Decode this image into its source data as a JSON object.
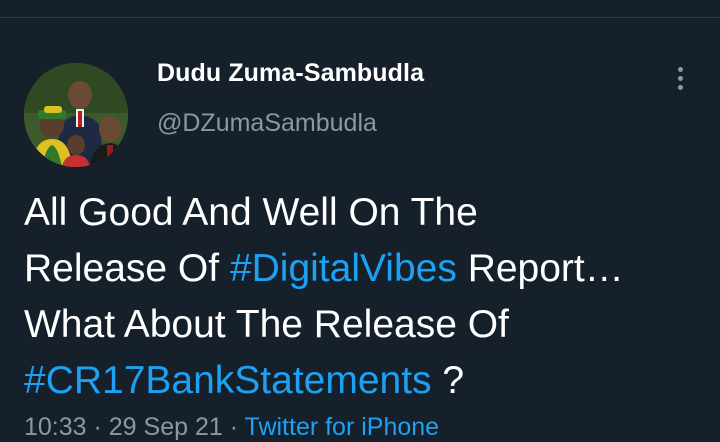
{
  "author": {
    "display_name": "Dudu Zuma-Sambudla",
    "handle": "@DZumaSambudla"
  },
  "tweet": {
    "line1": "All Good And Well On The",
    "line2_prefix": "Release Of ",
    "line2_hashtag": "#DigitalVibes",
    "line2_suffix": " Report…",
    "line3": "What About The Release Of",
    "line4_hashtag": "#CR17BankStatements",
    "line4_suffix": " ?"
  },
  "meta": {
    "time": "10:33",
    "separator": " · ",
    "date": "29 Sep 21",
    "source": "Twitter for iPhone"
  },
  "icons": {
    "more": "more-vertical-icon"
  },
  "colors": {
    "background": "#15202b",
    "hashtag": "#1da1f2",
    "secondary_text": "#8899a6"
  }
}
